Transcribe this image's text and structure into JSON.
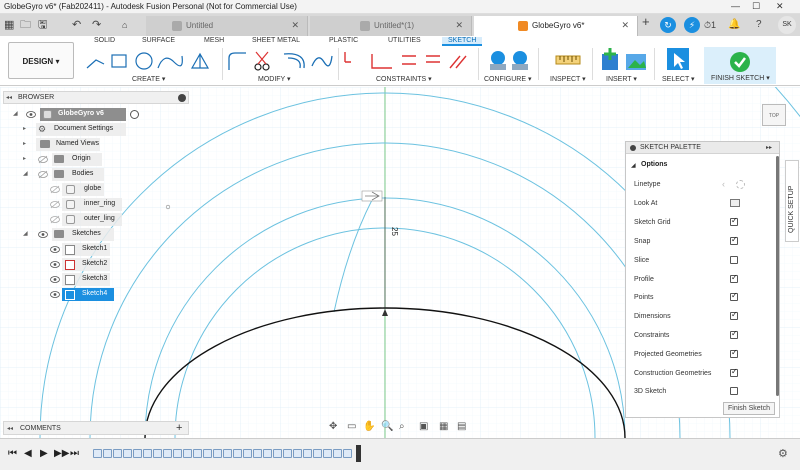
{
  "window": {
    "title": "GlobeGyro v6* (Fab202411) - Autodesk Fusion Personal (Not for Commercial Use)",
    "controls": [
      "—",
      "☐",
      "✕"
    ]
  },
  "tabs": [
    {
      "label": "Untitled",
      "close": "✕"
    },
    {
      "label": "Untitled*(1)",
      "close": "✕"
    },
    {
      "label": "GlobeGyro v6*",
      "close": "✕"
    }
  ],
  "tab_add": "+",
  "account": {
    "initials": "SK",
    "job_count": "1",
    "clock": "⏱"
  },
  "ribbon": {
    "workspace": "DESIGN",
    "workspace_arrow": "▾",
    "tabs": [
      "SOLID",
      "SURFACE",
      "MESH",
      "SHEET METAL",
      "PLASTIC",
      "UTILITIES",
      "SKETCH"
    ],
    "active_tab": "SKETCH",
    "groups": [
      "CREATE",
      "MODIFY",
      "CONSTRAINTS",
      "CONFIGURE",
      "INSPECT",
      "INSERT",
      "SELECT",
      "FINISH SKETCH"
    ]
  },
  "browser": {
    "title": "BROWSER",
    "collapse": "◂◂",
    "items": [
      {
        "label": "GlobeGyro v6",
        "type": "root"
      },
      {
        "label": "Document Settings",
        "type": "settings"
      },
      {
        "label": "Named Views",
        "type": "folder"
      },
      {
        "label": "Origin",
        "type": "folder"
      },
      {
        "label": "Bodies",
        "type": "folder"
      },
      {
        "label": "globe",
        "type": "body"
      },
      {
        "label": "inner_ring",
        "type": "body"
      },
      {
        "label": "outer_ling",
        "type": "body"
      },
      {
        "label": "Sketches",
        "type": "folder"
      },
      {
        "label": "Sketch1",
        "type": "sketch"
      },
      {
        "label": "Sketch2",
        "type": "sketch"
      },
      {
        "label": "Sketch3",
        "type": "sketch"
      },
      {
        "label": "Sketch4",
        "type": "sketch",
        "selected": true
      }
    ]
  },
  "canvas": {
    "dimension_label": "25",
    "viewcube_label": "TOP"
  },
  "palette": {
    "title": "SKETCH PALETTE",
    "expand": "▸▸",
    "section": "Options",
    "linetype_label": "Linetype",
    "lookat_label": "Look At",
    "options": [
      {
        "label": "Sketch Grid",
        "checked": true
      },
      {
        "label": "Snap",
        "checked": true
      },
      {
        "label": "Slice",
        "checked": false
      },
      {
        "label": "Profile",
        "checked": true
      },
      {
        "label": "Points",
        "checked": true
      },
      {
        "label": "Dimensions",
        "checked": true
      },
      {
        "label": "Constraints",
        "checked": true
      },
      {
        "label": "Projected Geometries",
        "checked": true
      },
      {
        "label": "Construction Geometries",
        "checked": true
      },
      {
        "label": "3D Sketch",
        "checked": false
      }
    ],
    "finish_button": "Finish Sketch"
  },
  "quick_setup": "QUICK SETUP",
  "comments": {
    "title": "COMMENTS",
    "add": "+"
  },
  "timeline": {
    "controls": [
      "⏮",
      "◀",
      "▶",
      "▶▶",
      "⏭"
    ]
  },
  "colors": {
    "accent": "#1b8fe0",
    "finish_green": "#2bb34a",
    "construction": "#6cc2e0",
    "grid": "#eaf5fb",
    "axis_green": "#5cbc6a"
  }
}
